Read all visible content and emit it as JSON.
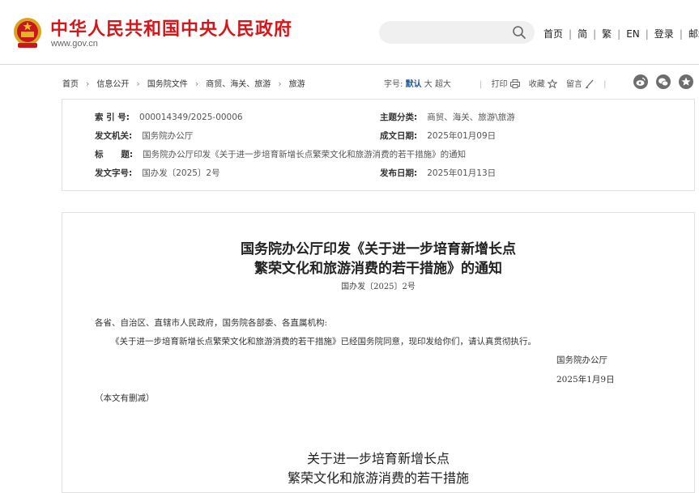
{
  "header": {
    "site_name": "中华人民共和国中央人民政府",
    "site_url": "www.gov.cn",
    "emblem_icon": "national-emblem-icon",
    "search": {
      "placeholder": "",
      "icon": "search-icon"
    },
    "nav": [
      "首页",
      "简",
      "繁",
      "EN",
      "登录",
      "邮箱"
    ],
    "brand_color": "#d3171a"
  },
  "breadcrumb": [
    "首页",
    "信息公开",
    "国务院文件",
    "商贸、海关、旅游",
    "旅游"
  ],
  "font_size": {
    "label": "字号:",
    "options": [
      "默认",
      "大",
      "超大"
    ],
    "selected": "默认"
  },
  "tools": {
    "print_label": "打印",
    "favorite_label": "收藏",
    "comment_label": "留言",
    "share_icons": [
      "weibo-icon",
      "wechat-icon",
      "star-share-icon"
    ]
  },
  "meta": {
    "index_label": "索 引 号:",
    "index_value": "000014349/2025-00006",
    "subject_label": "主题分类:",
    "subject_value": "商贸、海关、旅游\\旅游",
    "issuer_label": "发文机关:",
    "issuer_value": "国务院办公厅",
    "written_label": "成文日期:",
    "written_value": "2025年01月09日",
    "title_label": "标      题:",
    "title_value": "国务院办公厅印发《关于进一步培育新增长点繁荣文化和旅游消费的若干措施》的通知",
    "docno_label": "发文字号:",
    "docno_value": "国办发〔2025〕2号",
    "published_label": "发布日期:",
    "published_value": "2025年01月13日"
  },
  "document": {
    "title_line1": "国务院办公厅印发《关于进一步培育新增长点",
    "title_line2": "繁荣文化和旅游消费的若干措施》的通知",
    "doc_number": "国办发〔2025〕2号",
    "salutation": "各省、自治区、直辖市人民政府，国务院各部委、各直属机构:",
    "body": "《关于进一步培育新增长点繁荣文化和旅游消费的若干措施》已经国务院同意，现印发给你们，请认真贯彻执行。",
    "signer": "国务院办公厅",
    "date": "2025年1月9日",
    "note": "（本文有删减）",
    "sub_title_line1": "关于进一步培育新增长点",
    "sub_title_line2": "繁荣文化和旅游消费的若干措施"
  }
}
